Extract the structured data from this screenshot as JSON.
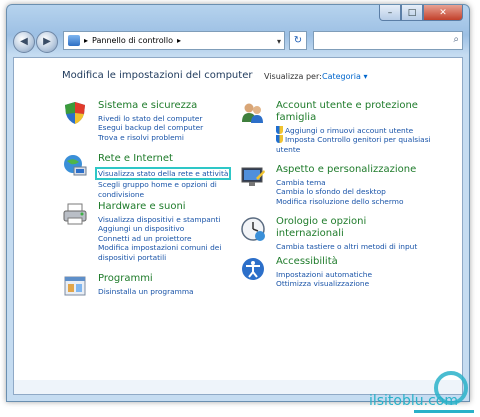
{
  "window": {
    "controls": {
      "minimize": "–",
      "maximize": "□",
      "close": "✕"
    }
  },
  "nav": {
    "back_glyph": "◀",
    "forward_glyph": "▶",
    "address_text": "Pannello di controllo",
    "address_sep": "▸",
    "address_arrow": "▾",
    "refresh_glyph": "↻",
    "search_value": "",
    "search_icon": "⌕"
  },
  "main": {
    "title": "Modifica le impostazioni del computer",
    "view_by_label": "Visualizza per:",
    "view_by_value": "Categoria ▾",
    "categories": [
      {
        "icon": "security-icon",
        "title": "Sistema e sicurezza",
        "links": [
          "Rivedi lo stato del computer",
          "Esegui backup del computer",
          "Trova e risolvi problemi"
        ]
      },
      {
        "icon": "network-icon",
        "title": "Rete e Internet",
        "links": [
          "Visualizza stato della rete e attività",
          "Scegli gruppo home e opzioni di condivisione"
        ]
      },
      {
        "icon": "printer-icon",
        "title": "Hardware e suoni",
        "links": [
          "Visualizza dispositivi e stampanti",
          "Aggiungi un dispositivo",
          "Connetti ad un proiettore",
          "Modifica impostazioni comuni dei dispositivi portatili"
        ]
      },
      {
        "icon": "programs-icon",
        "title": "Programmi",
        "links": [
          "Disinstalla un programma"
        ]
      },
      {
        "icon": "users-icon",
        "title": "Account utente e protezione famiglia",
        "links": [
          "Aggiungi o rimuovi account utente",
          "Imposta Controllo genitori per qualsiasi utente"
        ]
      },
      {
        "icon": "appearance-icon",
        "title": "Aspetto e personalizzazione",
        "links": [
          "Cambia tema",
          "Cambia lo sfondo del desktop",
          "Modifica risoluzione dello schermo"
        ]
      },
      {
        "icon": "clock-icon",
        "title": "Orologio e opzioni internazionali",
        "links": [
          "Cambia tastiere o altri metodi di input"
        ]
      },
      {
        "icon": "accessibility-icon",
        "title": "Accessibilità",
        "links": [
          "Impostazioni automatiche",
          "Ottimizza visualizzazione"
        ]
      }
    ]
  },
  "watermark": {
    "text": "ilsitoblu.com"
  },
  "colors": {
    "link": "#1a54a8",
    "category": "#1e7b2a",
    "highlight": "#2ec7c7",
    "watermark": "#2ab1c9"
  }
}
